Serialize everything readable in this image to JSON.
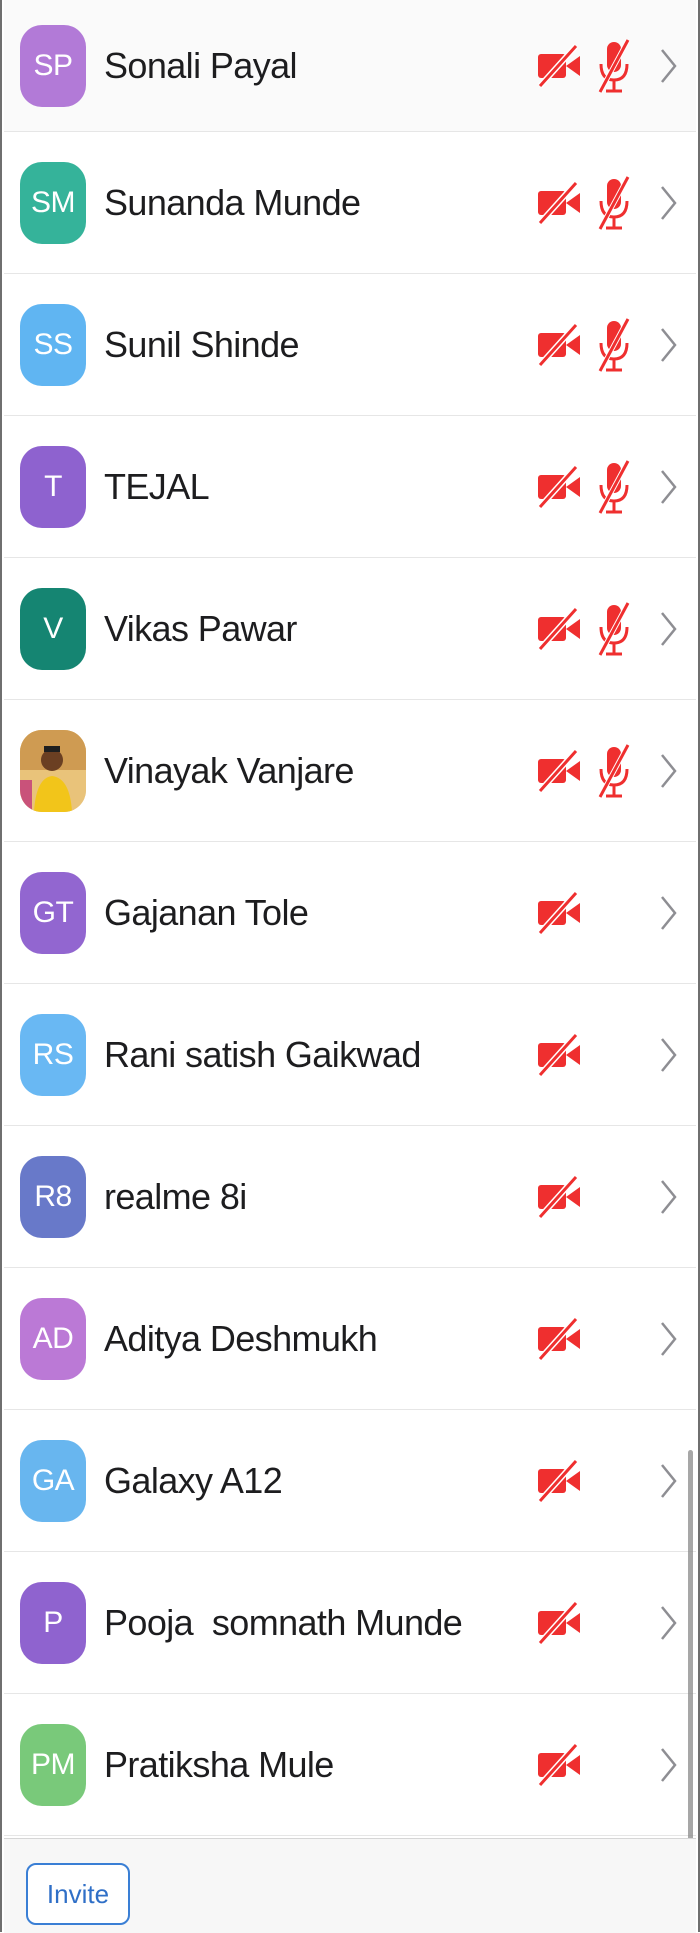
{
  "participants": [
    {
      "initials": "SP",
      "name": "Sonali Payal",
      "avatar_color": "#b27ad7",
      "video_muted": true,
      "audio_muted": true
    },
    {
      "initials": "SM",
      "name": "Sunanda Munde",
      "avatar_color": "#35b39a",
      "video_muted": true,
      "audio_muted": true
    },
    {
      "initials": "SS",
      "name": "Sunil Shinde",
      "avatar_color": "#60b5f2",
      "video_muted": true,
      "audio_muted": true
    },
    {
      "initials": "T",
      "name": "TEJAL",
      "avatar_color": "#8e62cf",
      "video_muted": true,
      "audio_muted": true
    },
    {
      "initials": "V",
      "name": "Vikas Pawar",
      "avatar_color": "#158572",
      "video_muted": true,
      "audio_muted": true
    },
    {
      "initials": "",
      "name": "Vinayak Vanjare",
      "avatar_color": "#d8b26a",
      "video_muted": true,
      "audio_muted": true,
      "photo": true
    },
    {
      "initials": "GT",
      "name": "Gajanan Tole",
      "avatar_color": "#9266d0",
      "video_muted": true,
      "audio_muted": false
    },
    {
      "initials": "RS",
      "name": "Rani satish Gaikwad",
      "avatar_color": "#69b8f3",
      "video_muted": true,
      "audio_muted": false
    },
    {
      "initials": "R8",
      "name": "realme 8i",
      "avatar_color": "#6879c9",
      "video_muted": true,
      "audio_muted": false
    },
    {
      "initials": "AD",
      "name": "Aditya Deshmukh",
      "avatar_color": "#bb79d6",
      "video_muted": true,
      "audio_muted": false
    },
    {
      "initials": "GA",
      "name": "Galaxy A12",
      "avatar_color": "#68b6ef",
      "video_muted": true,
      "audio_muted": false
    },
    {
      "initials": "P",
      "name": "Pooja  somnath Munde",
      "avatar_color": "#8f63cf",
      "video_muted": true,
      "audio_muted": false
    },
    {
      "initials": "PM",
      "name": "Pratiksha Mule",
      "avatar_color": "#79c97a",
      "video_muted": true,
      "audio_muted": false
    }
  ],
  "icons": {
    "video": "video-off-icon",
    "audio": "mic-off-icon",
    "chevron": "chevron-right-icon"
  },
  "colors": {
    "muted": "#ef2f2f",
    "chevron": "#8e8e93",
    "accent": "#2f6fc7"
  },
  "footer": {
    "invite_label": "Invite"
  }
}
